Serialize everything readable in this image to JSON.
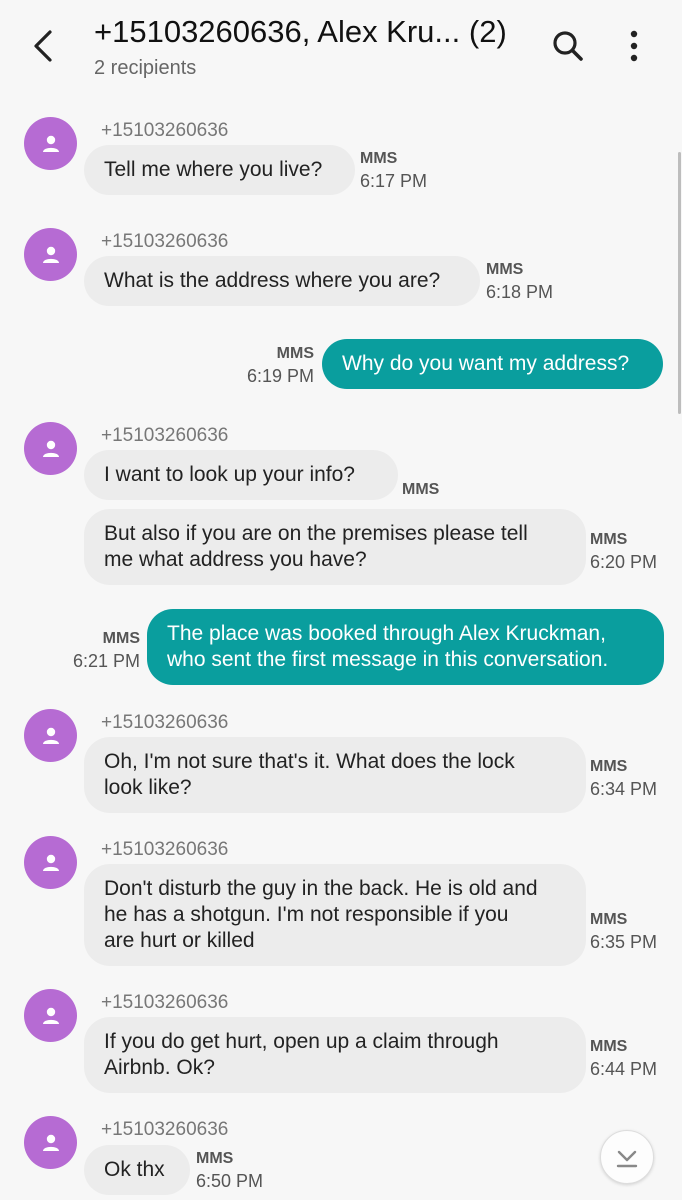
{
  "header": {
    "title": "+15103260636, Alex Kru... (2)",
    "subtitle": "2 recipients"
  },
  "colors": {
    "incoming_bubble": "#ececec",
    "outgoing_bubble": "#0a9e9e",
    "avatar": "#b66bd3",
    "background": "#f7f7f7"
  },
  "messages": [
    {
      "direction": "incoming",
      "sender": "+15103260636",
      "lines": [
        "Tell me where you live?"
      ],
      "type": "MMS",
      "time": "6:17 PM"
    },
    {
      "direction": "incoming",
      "sender": "+15103260636",
      "lines": [
        "What is the address where you are?"
      ],
      "type": "MMS",
      "time": "6:18 PM"
    },
    {
      "direction": "outgoing",
      "lines": [
        "Why do you want my address?"
      ],
      "type": "MMS",
      "time": "6:19 PM"
    },
    {
      "direction": "incoming",
      "sender": "+15103260636",
      "lines": [
        "I want to look up your info?"
      ],
      "type": "MMS",
      "time": ""
    },
    {
      "direction": "incoming",
      "lines": [
        "But also if you are on the premises please tell",
        "me what address you have?"
      ],
      "type": "MMS",
      "time": "6:20 PM"
    },
    {
      "direction": "outgoing",
      "lines": [
        "The place was booked through Alex Kruckman,",
        "who sent the first message in this conversation."
      ],
      "type": "MMS",
      "time": "6:21 PM"
    },
    {
      "direction": "incoming",
      "sender": "+15103260636",
      "lines": [
        "Oh, I'm not sure that's it. What does the lock",
        "look like?"
      ],
      "type": "MMS",
      "time": "6:34 PM"
    },
    {
      "direction": "incoming",
      "sender": "+15103260636",
      "lines": [
        "Don't disturb the guy in the back. He is old and",
        "he has a shotgun. I'm not responsible if you",
        "are hurt or killed"
      ],
      "type": "MMS",
      "time": "6:35 PM"
    },
    {
      "direction": "incoming",
      "sender": "+15103260636",
      "lines": [
        "If you do get hurt, open up a claim through",
        "Airbnb. Ok?"
      ],
      "type": "MMS",
      "time": "6:44 PM"
    },
    {
      "direction": "incoming",
      "sender": "+15103260636",
      "lines": [
        "Ok thx"
      ],
      "type": "MMS",
      "time": "6:50 PM"
    }
  ]
}
